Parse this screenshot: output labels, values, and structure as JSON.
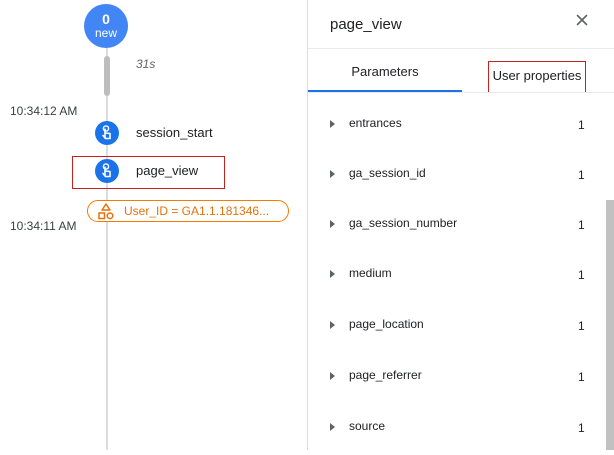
{
  "timeline": {
    "new_count": "0",
    "new_label": "new",
    "duration": "31s",
    "times": [
      "10:34:12 AM",
      "10:34:11 AM"
    ],
    "events": [
      {
        "label": "session_start"
      },
      {
        "label": "page_view"
      }
    ],
    "user_property": "User_ID = GA1.1.181346..."
  },
  "panel": {
    "title": "page_view",
    "close_symbol": "✕",
    "tabs": [
      {
        "label": "Parameters",
        "active": true
      },
      {
        "label": "User properties",
        "active": false
      }
    ],
    "parameters": [
      {
        "name": "entrances",
        "value": "1"
      },
      {
        "name": "ga_session_id",
        "value": "1"
      },
      {
        "name": "ga_session_number",
        "value": "1"
      },
      {
        "name": "medium",
        "value": "1"
      },
      {
        "name": "page_location",
        "value": "1"
      },
      {
        "name": "page_referrer",
        "value": "1"
      },
      {
        "name": "source",
        "value": "1"
      }
    ]
  },
  "colors": {
    "accent": "#1a73e8",
    "badge": "#4285f4",
    "highlight": "#c5221f",
    "user_property": "#e8710a"
  },
  "icons": {
    "event": "touch-icon",
    "user_property": "shapes-icon",
    "close": "close-icon",
    "expand": "caret-right-icon"
  }
}
